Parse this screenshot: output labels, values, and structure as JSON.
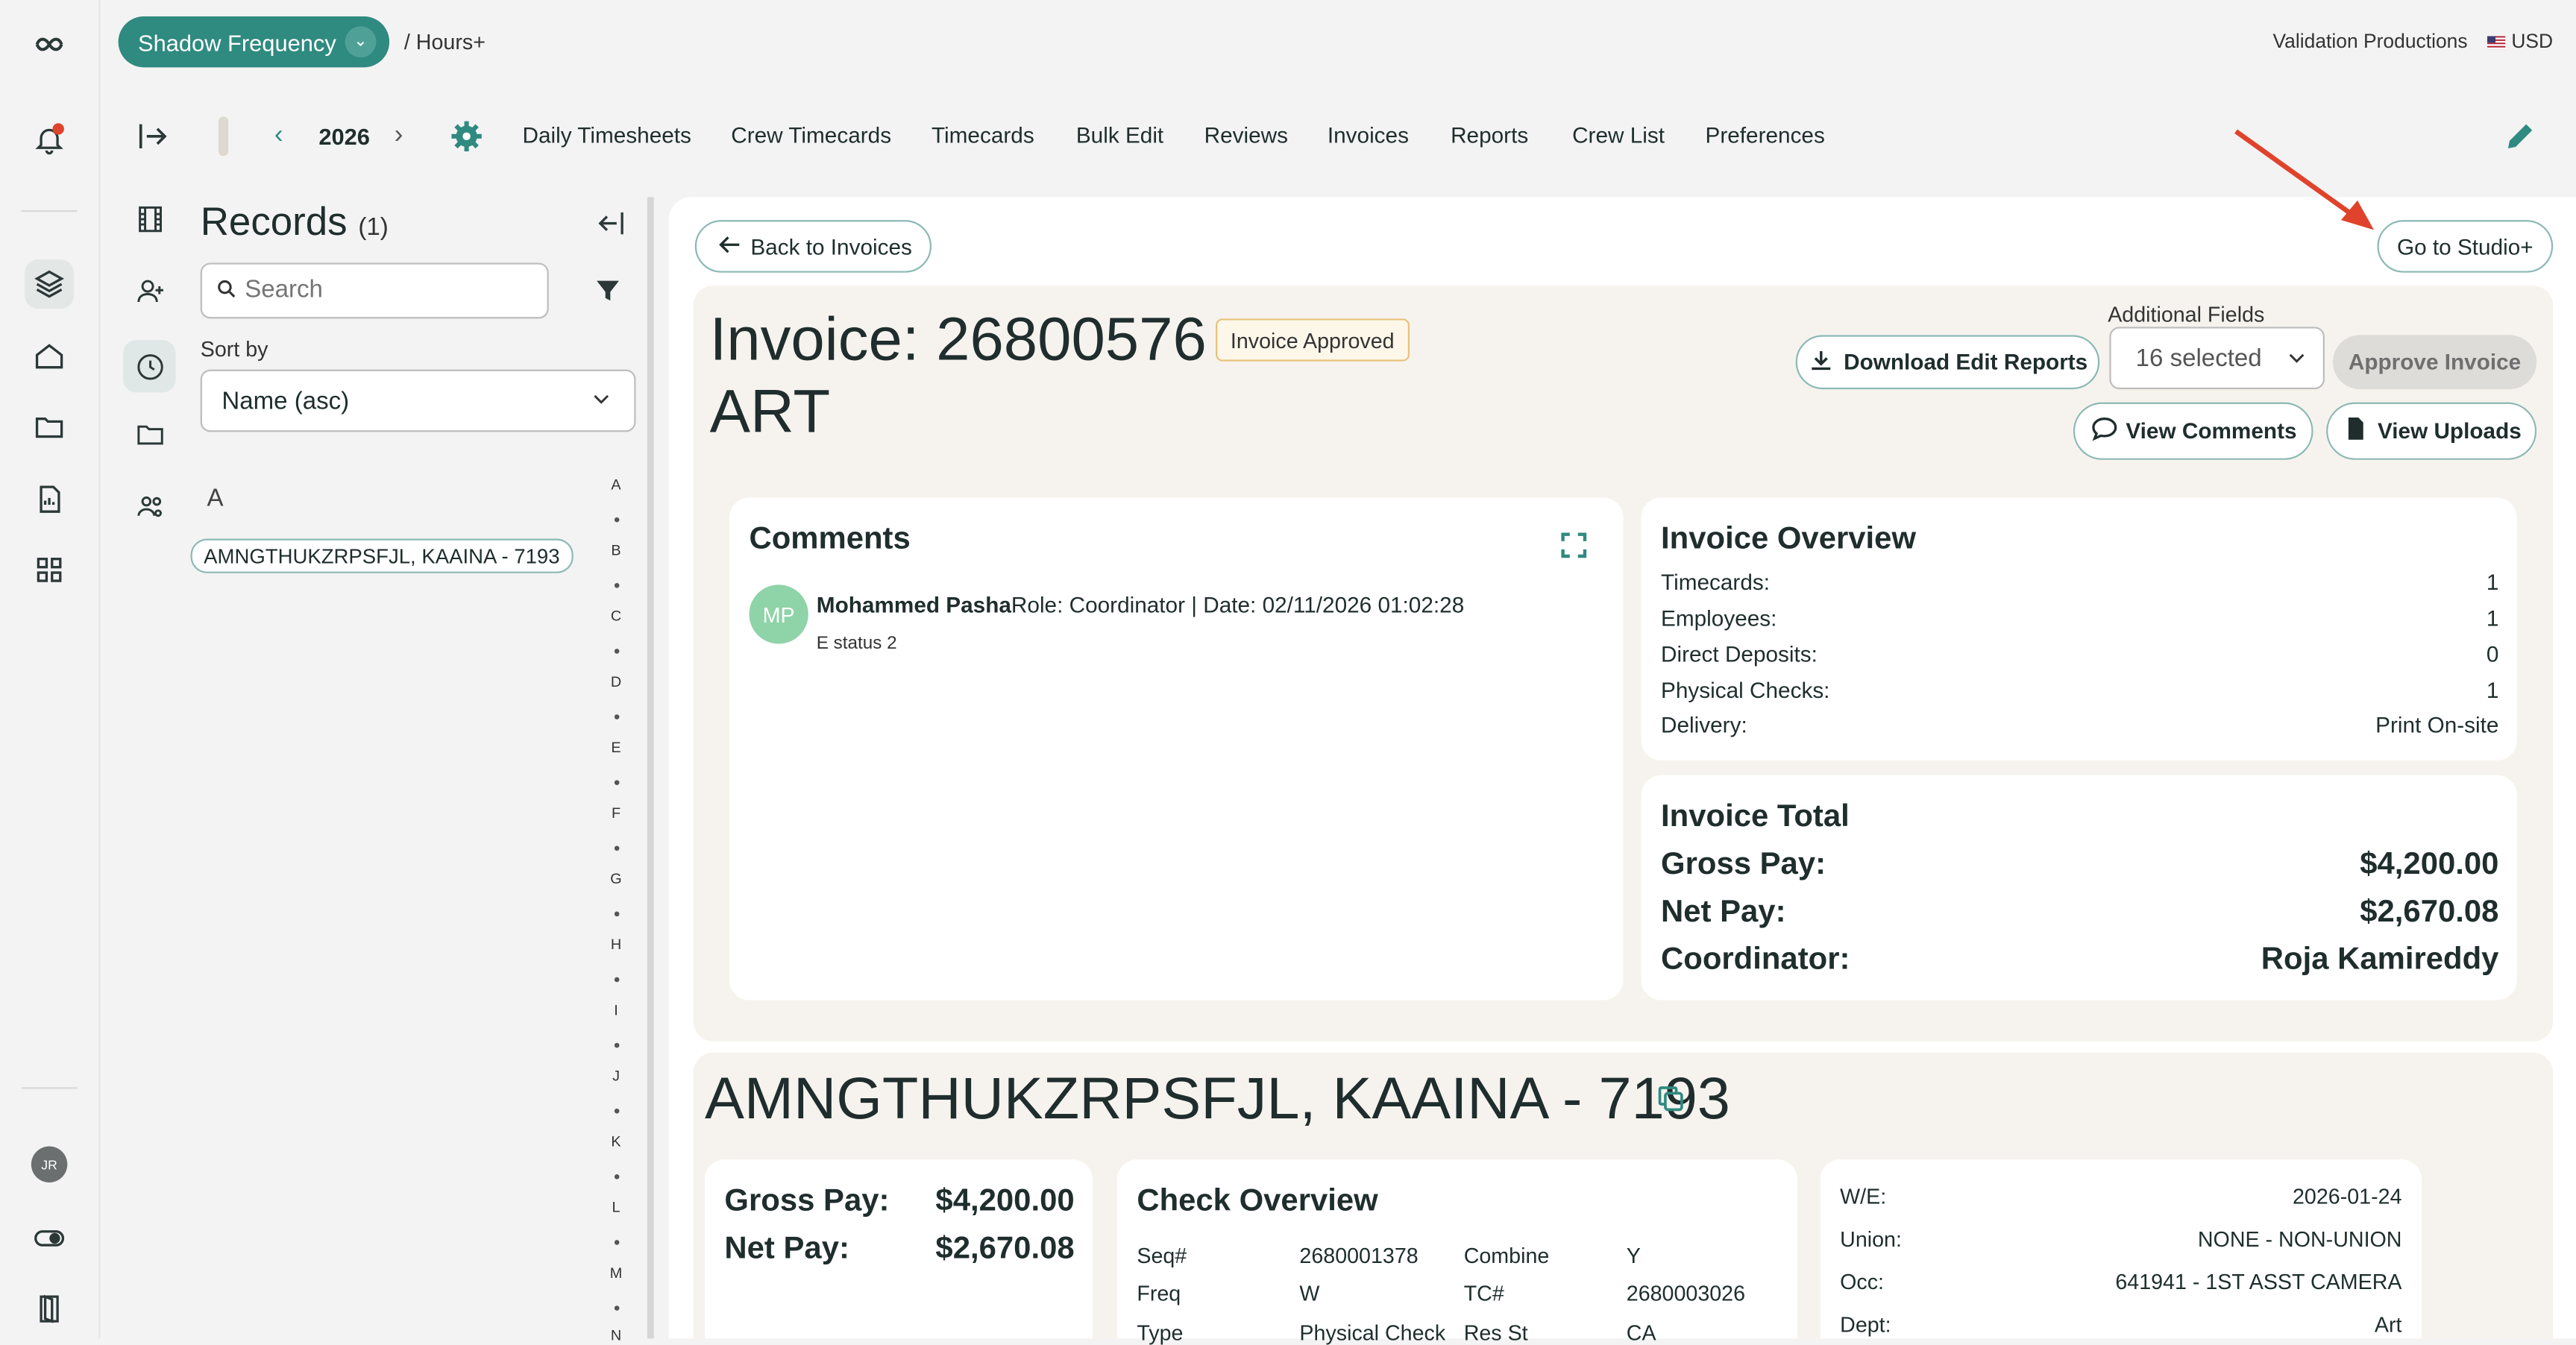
{
  "topbar": {
    "project": "Shadow Frequency",
    "breadcrumb": "/ Hours+",
    "company": "Validation Productions",
    "currency": "USD"
  },
  "nav": {
    "year": "2026",
    "items": [
      "Daily Timesheets",
      "Crew Timecards",
      "Timecards",
      "Bulk Edit",
      "Reviews",
      "Invoices",
      "Reports",
      "Crew List",
      "Preferences"
    ]
  },
  "user": {
    "initials": "JR"
  },
  "records": {
    "title": "Records",
    "count": "(1)",
    "search_placeholder": "Search",
    "sort_label": "Sort by",
    "sort_value": "Name (asc)",
    "group_letter": "A",
    "items": [
      "AMNGTHUKZRPSFJL, KAAINA - 7193"
    ],
    "alphabet": [
      "A",
      "B",
      "C",
      "D",
      "E",
      "F",
      "G",
      "H",
      "I",
      "J",
      "K",
      "L",
      "M",
      "N"
    ]
  },
  "invoice": {
    "back_label": "Back to Invoices",
    "studio_label": "Go to Studio+",
    "title": "Invoice: 26800576",
    "subtitle": "ART",
    "status": "Invoice Approved",
    "download_label": "Download Edit Reports",
    "additional_fields_label": "Additional Fields",
    "additional_fields_value": "16 selected",
    "approve_label": "Approve Invoice",
    "comments_btn": "View Comments",
    "uploads_btn": "View Uploads"
  },
  "comments": {
    "title": "Comments",
    "avatar": "MP",
    "author": "Mohammed Pasha",
    "meta": "Role: Coordinator | Date: 02/11/2026 01:02:28",
    "text": "E status 2"
  },
  "overview": {
    "title": "Invoice Overview",
    "rows": [
      {
        "label": "Timecards:",
        "value": "1"
      },
      {
        "label": "Employees:",
        "value": "1"
      },
      {
        "label": "Direct Deposits:",
        "value": "0"
      },
      {
        "label": "Physical Checks:",
        "value": "1"
      },
      {
        "label": "Delivery:",
        "value": "Print On-site"
      }
    ]
  },
  "total": {
    "title": "Invoice Total",
    "rows": [
      {
        "label": "Gross Pay:",
        "value": "$4,200.00"
      },
      {
        "label": "Net Pay:",
        "value": "$2,670.08"
      },
      {
        "label": "Coordinator:",
        "value": "Roja Kamireddy"
      }
    ]
  },
  "employee": {
    "name": "AMNGTHUKZRPSFJL, KAAINA - 7193",
    "gross_label": "Gross Pay:",
    "gross_value": "$4,200.00",
    "net_label": "Net Pay:",
    "net_value": "$2,670.08",
    "check_title": "Check Overview",
    "check_rows": [
      [
        "Seq#",
        "2680001378",
        "Combine",
        "Y"
      ],
      [
        "Freq",
        "W",
        "TC#",
        "2680003026"
      ],
      [
        "Type",
        "Physical Check",
        "Res St",
        "CA"
      ]
    ],
    "details": [
      {
        "label": "W/E:",
        "value": "2026-01-24"
      },
      {
        "label": "Union:",
        "value": "NONE - NON-UNION"
      },
      {
        "label": "Occ:",
        "value": "641941 - 1ST ASST CAMERA"
      },
      {
        "label": "Dept:",
        "value": "Art"
      }
    ]
  },
  "colors": {
    "accent": "#2f8a80",
    "annotation_arrow": "#e0432b",
    "status_border": "#e8c27a"
  }
}
